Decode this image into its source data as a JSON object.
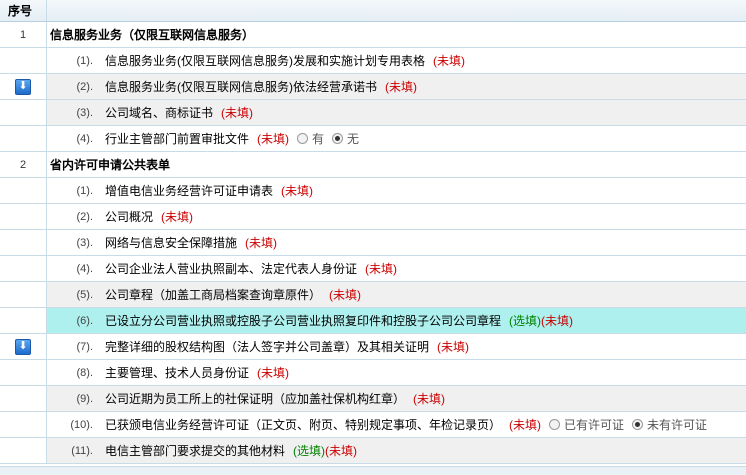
{
  "header": {
    "col_num": "序号"
  },
  "sections": [
    {
      "num": "1",
      "title": "信息服务业务（仅限互联网信息服务）",
      "items": [
        {
          "idx": "(1).",
          "text": "信息服务业务(仅限互联网信息服务)发展和实施计划专用表格",
          "req": "(未填)"
        },
        {
          "idx": "(2).",
          "text": "信息服务业务(仅限互联网信息服务)依法经营承诺书",
          "req": "(未填)",
          "download": true
        },
        {
          "idx": "(3).",
          "text": "公司域名、商标证书",
          "req": "(未填)"
        },
        {
          "idx": "(4).",
          "text": "行业主管部门前置审批文件",
          "req": "(未填)",
          "radios": [
            {
              "label": "有",
              "checked": false
            },
            {
              "label": "无",
              "checked": true
            }
          ]
        }
      ]
    },
    {
      "num": "2",
      "title": "省内许可申请公共表单",
      "items": [
        {
          "idx": "(1).",
          "text": "增值电信业务经营许可证申请表",
          "req": "(未填)"
        },
        {
          "idx": "(2).",
          "text": "公司概况",
          "req": "(未填)"
        },
        {
          "idx": "(3).",
          "text": "网络与信息安全保障措施",
          "req": "(未填)"
        },
        {
          "idx": "(4).",
          "text": "公司企业法人营业执照副本、法定代表人身份证",
          "req": "(未填)"
        },
        {
          "idx": "(5).",
          "text": "公司章程（加盖工商局档案查询章原件）",
          "req": "(未填)"
        },
        {
          "idx": "(6).",
          "text": "已设立分公司营业执照或控股子公司营业执照复印件和控股子公司公司章程",
          "opt": "(选填)",
          "req": "(未填)",
          "highlight": true
        },
        {
          "idx": "(7).",
          "text": "完整详细的股权结构图（法人签字并公司盖章）及其相关证明",
          "req": "(未填)",
          "download": true
        },
        {
          "idx": "(8).",
          "text": "主要管理、技术人员身份证",
          "req": "(未填)"
        },
        {
          "idx": "(9).",
          "text": "公司近期为员工所上的社保证明（应加盖社保机构红章）",
          "req": "(未填)"
        },
        {
          "idx": "(10).",
          "text": "已获颁电信业务经营许可证（正文页、附页、特别规定事项、年检记录页）",
          "req": "(未填)",
          "radios": [
            {
              "label": "已有许可证",
              "checked": false
            },
            {
              "label": "未有许可证",
              "checked": true
            }
          ]
        },
        {
          "idx": "(11).",
          "text": "电信主管部门要求提交的其他材料",
          "opt": "(选填)",
          "req": "(未填)"
        }
      ]
    }
  ],
  "icons": {
    "download": "download-arrow-icon",
    "radio": "radio-icon"
  },
  "colors": {
    "required": "#cc0000",
    "optional": "#008000",
    "highlight_row": "#aef0ee",
    "alt_row": "#f0f0f0",
    "border": "#c8dce8"
  }
}
